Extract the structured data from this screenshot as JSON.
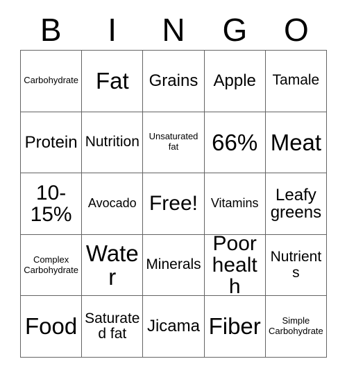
{
  "card": {
    "title": "BINGO",
    "header_letters": [
      "B",
      "I",
      "N",
      "G",
      "O"
    ],
    "border_color": "#636363",
    "background_color": "#ffffff",
    "text_color": "#000000",
    "rows": 5,
    "columns": 5,
    "cells": [
      [
        {
          "text": "Carbohydrate",
          "size": "xs"
        },
        {
          "text": "Fat",
          "size": "xxl"
        },
        {
          "text": "Grains",
          "size": "l"
        },
        {
          "text": "Apple",
          "size": "l"
        },
        {
          "text": "Tamale",
          "size": "m"
        }
      ],
      [
        {
          "text": "Protein",
          "size": "l"
        },
        {
          "text": "Nutrition",
          "size": "m"
        },
        {
          "text": "Unsaturated fat",
          "size": "xs"
        },
        {
          "text": "66%",
          "size": "xxl"
        },
        {
          "text": "Meat",
          "size": "xxl"
        }
      ],
      [
        {
          "text": "10-15%",
          "size": "xl"
        },
        {
          "text": "Avocado",
          "size": "s"
        },
        {
          "text": "Free!",
          "size": "xl"
        },
        {
          "text": "Vitamins",
          "size": "s"
        },
        {
          "text": "Leafy greens",
          "size": "l"
        }
      ],
      [
        {
          "text": "Complex Carbohydrate",
          "size": "xs"
        },
        {
          "text": "Water",
          "size": "xxl"
        },
        {
          "text": "Minerals",
          "size": "m"
        },
        {
          "text": "Poor health",
          "size": "xl"
        },
        {
          "text": "Nutrients",
          "size": "m"
        }
      ],
      [
        {
          "text": "Food",
          "size": "xxl"
        },
        {
          "text": "Saturated fat",
          "size": "m"
        },
        {
          "text": "Jicama",
          "size": "l"
        },
        {
          "text": "Fiber",
          "size": "xxl"
        },
        {
          "text": "Simple Carbohydrate",
          "size": "xs"
        }
      ]
    ]
  }
}
